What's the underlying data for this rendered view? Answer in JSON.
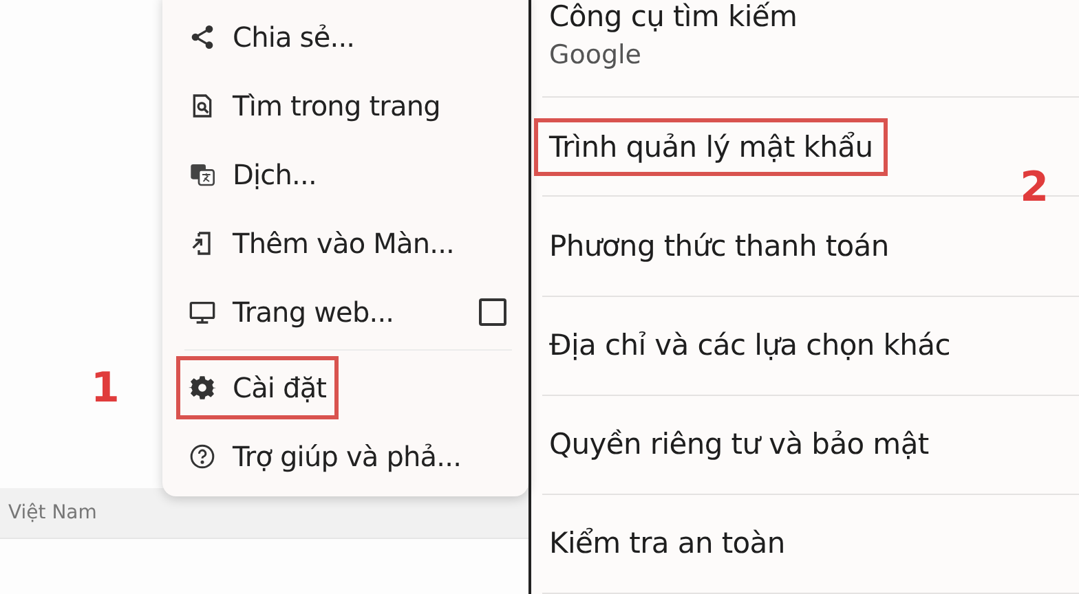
{
  "menu": {
    "items": [
      {
        "kind": "item",
        "label": "Chia sẻ...",
        "highlighted": false
      },
      {
        "kind": "item",
        "label": "Tìm trong trang",
        "highlighted": false
      },
      {
        "kind": "item",
        "label": "Dịch...",
        "highlighted": false
      },
      {
        "kind": "item",
        "label": "Thêm vào Màn...",
        "highlighted": false
      },
      {
        "kind": "checkbox",
        "label": "Trang web...",
        "checked": false,
        "highlighted": false
      },
      {
        "kind": "divider"
      },
      {
        "kind": "item",
        "label": "Cài đặt",
        "highlighted": true,
        "callout": "1"
      },
      {
        "kind": "item",
        "label": "Trợ giúp và phả...",
        "highlighted": false
      }
    ]
  },
  "location_bar": {
    "text": "Việt Nam"
  },
  "settings": {
    "items": [
      {
        "title": "Công cụ tìm kiếm",
        "subtitle": "Google",
        "highlighted": false
      },
      {
        "title": "Trình quản lý mật khẩu",
        "highlighted": true,
        "callout": "2"
      },
      {
        "title": "Phương thức thanh toán",
        "highlighted": false
      },
      {
        "title": "Địa chỉ và các lựa chọn khác",
        "highlighted": false
      },
      {
        "title": "Quyền riêng tư và bảo mật",
        "highlighted": false
      },
      {
        "title": "Kiểm tra an toàn",
        "highlighted": false
      }
    ]
  }
}
